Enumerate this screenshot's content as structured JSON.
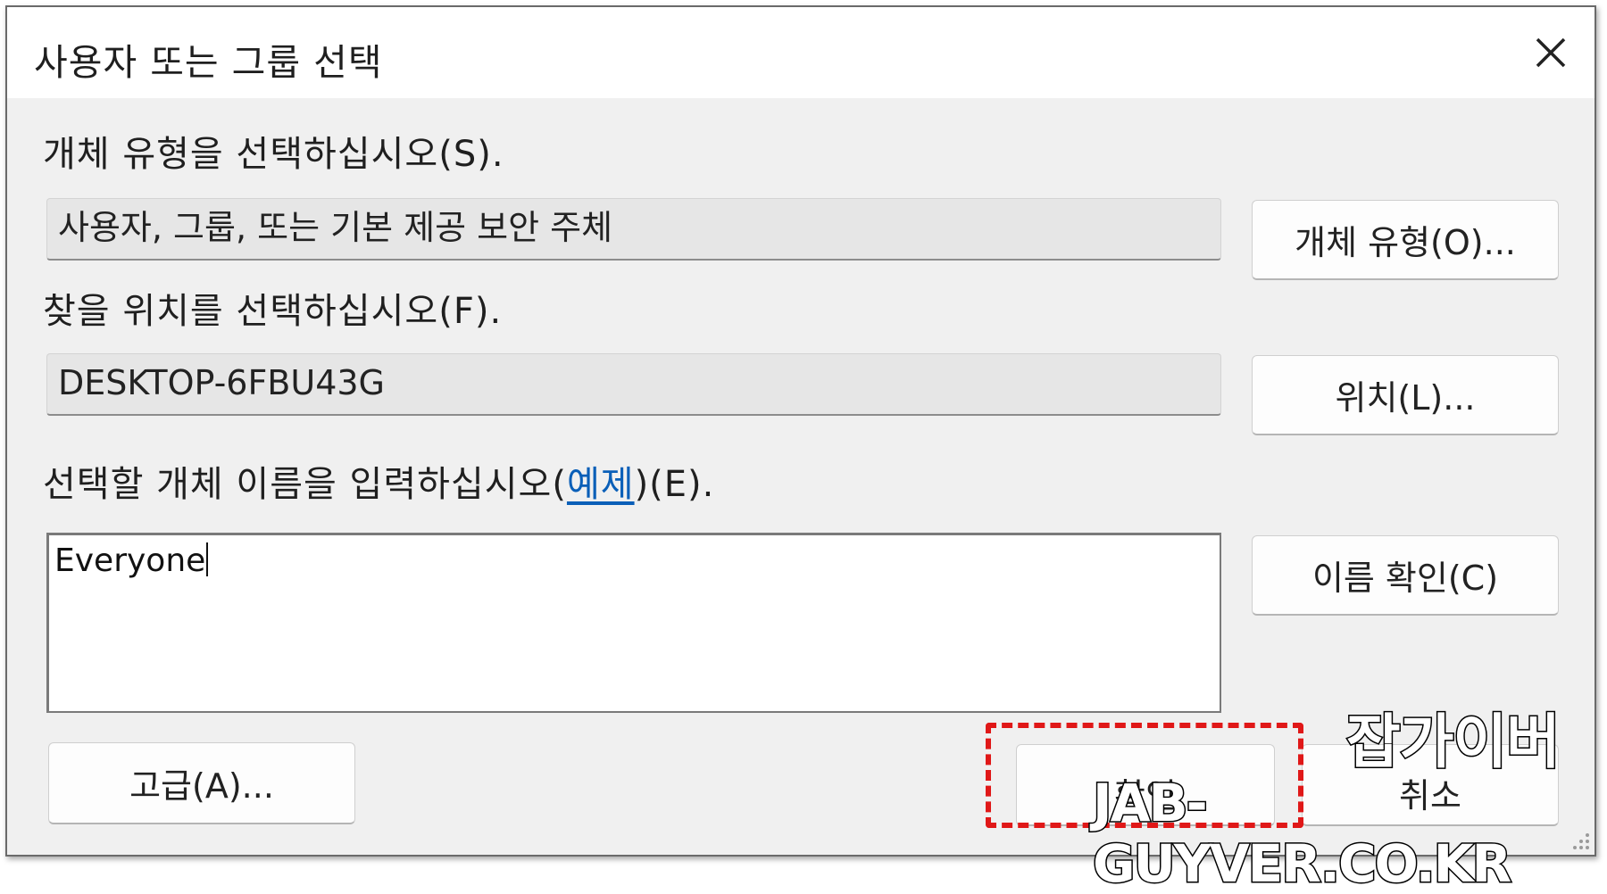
{
  "window": {
    "title": "사용자 또는 그룹 선택"
  },
  "object_type": {
    "label": "개체 유형을 선택하십시오(S).",
    "value": "사용자, 그룹, 또는 기본 제공 보안 주체",
    "button": "개체 유형(O)..."
  },
  "location": {
    "label": "찾을 위치를 선택하십시오(F).",
    "value": "DESKTOP-6FBU43G",
    "button": "위치(L)..."
  },
  "names": {
    "label_prefix": "선택할 개체 이름을 입력하십시오(",
    "label_link": "예제",
    "label_suffix": ")(E).",
    "value": "Everyone",
    "check_button": "이름 확인(C)"
  },
  "footer": {
    "advanced_button": "고급(A)...",
    "ok_button": "확인",
    "cancel_button": "취소"
  },
  "watermark": {
    "korean": "잡가이버",
    "domain": "JAB-GUYVER.CO.KR"
  },
  "colors": {
    "highlight": "#e01818",
    "link": "#0a5fb8",
    "dialog_bg": "#f0f0f0"
  }
}
